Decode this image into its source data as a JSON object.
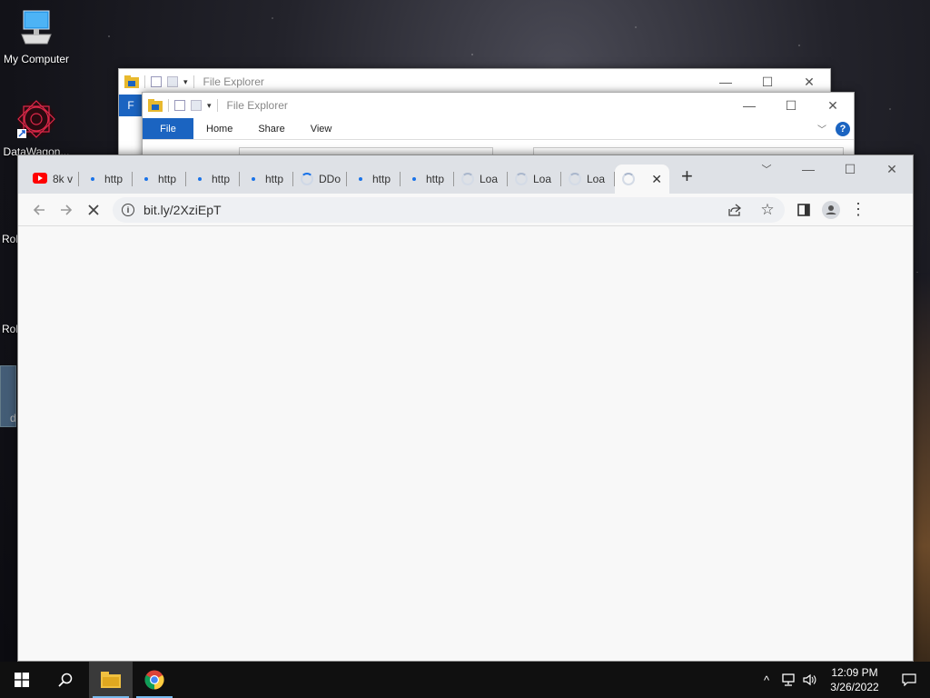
{
  "desktop": {
    "icons": [
      {
        "label": "My Computer"
      },
      {
        "label": "DataWagon..."
      }
    ],
    "partial_labels": [
      "Rob",
      "Rob",
      "d"
    ]
  },
  "explorer_back": {
    "title": "File Explorer",
    "file_tab": "F"
  },
  "explorer_front": {
    "title": "File Explorer",
    "ribbon": {
      "file": "File",
      "home": "Home",
      "share": "Share",
      "view": "View"
    }
  },
  "chrome": {
    "tabs": [
      {
        "label": "8k v",
        "favicon": "youtube-icon"
      },
      {
        "label": "http",
        "favicon": "loading-dot"
      },
      {
        "label": "http",
        "favicon": "loading-dot"
      },
      {
        "label": "http",
        "favicon": "loading-dot"
      },
      {
        "label": "http",
        "favicon": "loading-dot"
      },
      {
        "label": "DDo",
        "favicon": "spinner"
      },
      {
        "label": "http",
        "favicon": "loading-dot"
      },
      {
        "label": "http",
        "favicon": "loading-dot"
      },
      {
        "label": "Loa",
        "favicon": "spinner"
      },
      {
        "label": "Loa",
        "favicon": "spinner"
      },
      {
        "label": "Loa",
        "favicon": "spinner"
      },
      {
        "label": "",
        "favicon": "spinner",
        "active": true
      }
    ],
    "url": "bit.ly/2XziEpT"
  },
  "taskbar": {
    "time": "12:09 PM",
    "date": "3/26/2022"
  },
  "colors": {
    "accent": "#1b64c1",
    "chrome_tabstrip": "#dee1e6",
    "taskbar": "#101010"
  }
}
